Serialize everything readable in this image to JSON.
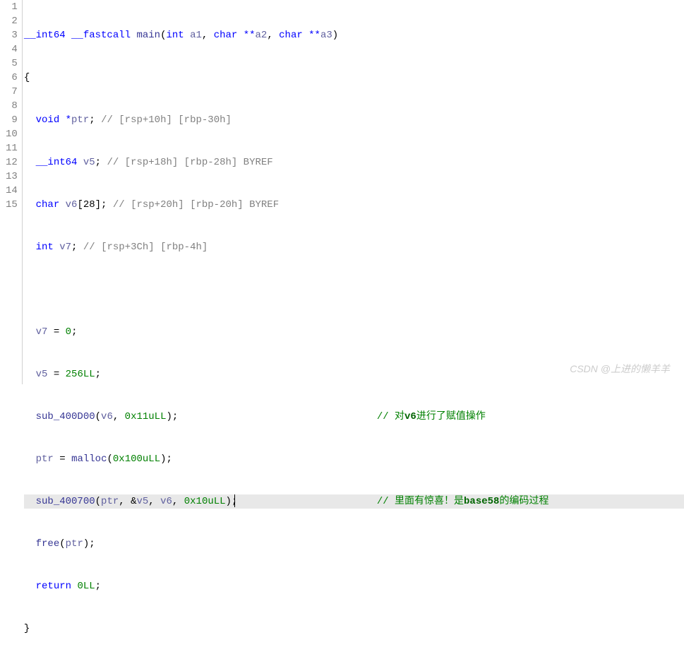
{
  "lines": {
    "l1_kw": "__int64 __fastcall ",
    "l1_fn": "main",
    "l1_paren_open": "(",
    "l1_kw2": "int ",
    "l1_a1": "a1",
    "l1_c1": ", ",
    "l1_kw3": "char **",
    "l1_a2": "a2",
    "l1_c2": ", ",
    "l1_kw4": "char **",
    "l1_a3": "a3",
    "l1_paren_close": ")",
    "l2": "{",
    "l3_kw": "  void *",
    "l3_var": "ptr",
    "l3_sc": "; ",
    "l3_com": "// [rsp+10h] [rbp-30h]",
    "l4_kw": "  __int64 ",
    "l4_var": "v5",
    "l4_sc": "; ",
    "l4_com": "// [rsp+18h] [rbp-28h] BYREF",
    "l5_kw": "  char ",
    "l5_var": "v6",
    "l5_arr": "[28]; ",
    "l5_com": "// [rsp+20h] [rbp-20h] BYREF",
    "l6_kw": "  int ",
    "l6_var": "v7",
    "l6_sc": "; ",
    "l6_com": "// [rsp+3Ch] [rbp-4h]",
    "l8_ind": "  ",
    "l8_var": "v7",
    "l8_eq": " = ",
    "l8_num": "0",
    "l8_sc": ";",
    "l9_ind": "  ",
    "l9_var": "v5",
    "l9_eq": " = ",
    "l9_num": "256LL",
    "l9_sc": ";",
    "l10_ind": "  ",
    "l10_fn": "sub_400D00",
    "l10_po": "(",
    "l10_a1": "v6",
    "l10_c": ", ",
    "l10_a2": "0x11uLL",
    "l10_pc": ");",
    "l10_com_lead": "// ",
    "l10_com_t1": "对",
    "l10_com_bold": "v6",
    "l10_com_t2": "进行了赋值操作",
    "l11_ind": "  ",
    "l11_var": "ptr",
    "l11_eq": " = ",
    "l11_fn": "malloc",
    "l11_po": "(",
    "l11_a": "0x100uLL",
    "l11_pc": ");",
    "l12_ind": "  ",
    "l12_fn": "sub_400700",
    "l12_po": "(",
    "l12_a1": "ptr",
    "l12_c1": ", &",
    "l12_a2": "v5",
    "l12_c2": ", ",
    "l12_a3": "v6",
    "l12_c3": ", ",
    "l12_a4": "0x10uLL",
    "l12_pc": ");",
    "l12_com_lead": "// ",
    "l12_com_t1": "里面有惊喜！是",
    "l12_com_bold": "base58",
    "l12_com_t2": "的编码过程",
    "l13_ind": "  ",
    "l13_fn": "free",
    "l13_po": "(",
    "l13_a": "ptr",
    "l13_pc": ");",
    "l14_ind": "  ",
    "l14_kw": "return ",
    "l14_num": "0LL",
    "l14_sc": ";",
    "l15": "}"
  },
  "line_numbers": [
    "1",
    "2",
    "3",
    "4",
    "5",
    "6",
    "7",
    "8",
    "9",
    "10",
    "11",
    "12",
    "13",
    "14",
    "15"
  ],
  "watermark": "CSDN @上进的懒羊羊"
}
